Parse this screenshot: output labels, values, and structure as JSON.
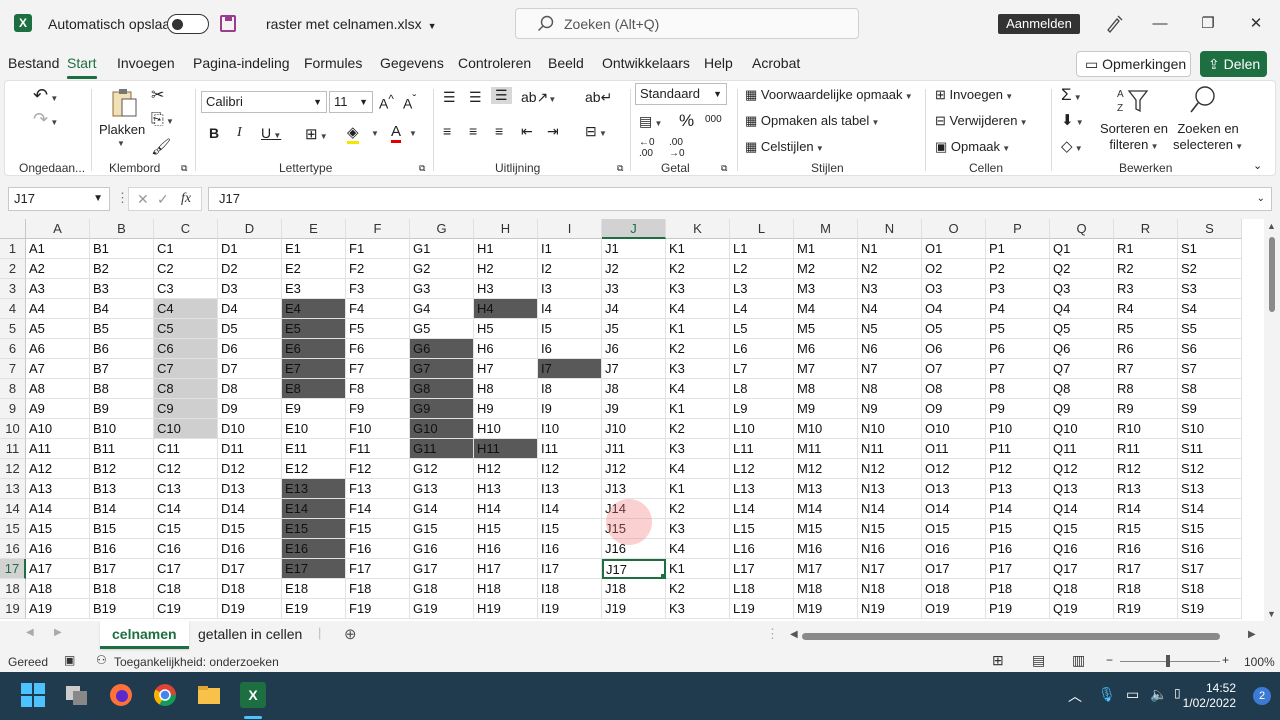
{
  "titlebar": {
    "autosave_label": "Automatisch opslaan",
    "filename": "raster met celnamen.xlsx",
    "search_placeholder": "Zoeken (Alt+Q)",
    "signin_label": "Aanmelden"
  },
  "menu": {
    "tabs": [
      "Bestand",
      "Start",
      "Invoegen",
      "Pagina-indeling",
      "Formules",
      "Gegevens",
      "Controleren",
      "Beeld",
      "Ontwikkelaars",
      "Help",
      "Acrobat"
    ],
    "active_tab": "Start",
    "comments_label": "Opmerkingen",
    "share_label": "Delen"
  },
  "ribbon": {
    "groups": {
      "undo": "Ongedaan...",
      "clipboard": "Klembord",
      "font": "Lettertype",
      "alignment": "Uitlijning",
      "number": "Getal",
      "styles": "Stijlen",
      "cells": "Cellen",
      "editing": "Bewerken"
    },
    "paste_label": "Plakken",
    "font_name": "Calibri",
    "font_size": "11",
    "number_format": "Standaard",
    "conditional_formatting": "Voorwaardelijke opmaak",
    "format_as_table": "Opmaken als tabel",
    "cell_styles": "Celstijlen",
    "insert": "Invoegen",
    "delete": "Verwijderen",
    "format": "Opmaak",
    "sort_filter_1": "Sorteren en",
    "sort_filter_2": "filteren",
    "find_select_1": "Zoeken en",
    "find_select_2": "selecteren"
  },
  "formulabar": {
    "namebox": "J17",
    "formula": "J17",
    "fx_label": "fx"
  },
  "grid": {
    "columns": [
      "A",
      "B",
      "C",
      "D",
      "E",
      "F",
      "G",
      "H",
      "I",
      "J",
      "K",
      "L",
      "M",
      "N",
      "O",
      "P",
      "Q",
      "R",
      "S"
    ],
    "first_row": 1,
    "row_count": 19,
    "selected_column": "J",
    "selected_row": 17,
    "active_cell": "J17",
    "k_cycle": [
      "K1",
      "K2",
      "K3",
      "K4"
    ],
    "light_fill": [
      "C4",
      "C5",
      "C6",
      "C7",
      "C8",
      "C9",
      "C10"
    ],
    "dark_fill": [
      "E4",
      "E5",
      "E6",
      "E7",
      "E8",
      "E13",
      "E14",
      "E15",
      "E16",
      "E17",
      "G6",
      "G7",
      "G8",
      "G9",
      "G10",
      "G11",
      "H4",
      "H11",
      "I7"
    ]
  },
  "sheets": {
    "tabs": [
      "celnamen",
      "getallen in cellen"
    ],
    "active": "celnamen"
  },
  "status": {
    "ready": "Gereed",
    "accessibility": "Toegankelijkheid: onderzoeken",
    "zoom": "100%"
  },
  "taskbar": {
    "time": "14:52",
    "date": "1/02/2022",
    "badge": "2"
  },
  "colors": {
    "accent": "#1d6f42",
    "light_fill": "#cfcfcf",
    "dark_fill": "#595959"
  }
}
